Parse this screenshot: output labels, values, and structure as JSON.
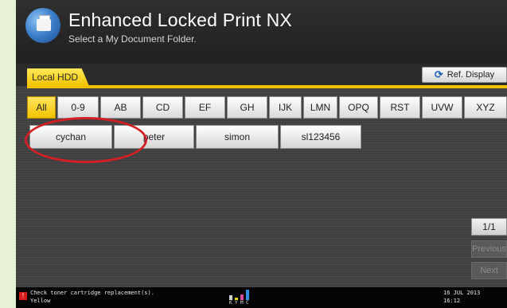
{
  "header": {
    "title": "Enhanced Locked Print NX",
    "subtitle": "Select a My Document Folder."
  },
  "tabs": {
    "local_hdd": "Local HDD"
  },
  "ref_display": {
    "label": "Ref. Display",
    "icon": "refresh-icon"
  },
  "index_filters": [
    "All",
    "0-9",
    "AB",
    "CD",
    "EF",
    "GH",
    "IJK",
    "LMN",
    "OPQ",
    "RST",
    "UVW",
    "XYZ"
  ],
  "active_filter": "All",
  "folders": [
    "cychan",
    "peter",
    "simon",
    "sl123456"
  ],
  "highlighted_folder": "cychan",
  "pagination": {
    "page": "1/1",
    "previous": "Previous",
    "next": "Next"
  },
  "status": {
    "message_line1": "Check toner cartridge replacement(s).",
    "message_line2": "Yellow",
    "date": "16 JUL  2013",
    "time": "16:12",
    "toner_labels": [
      "K",
      "Y",
      "M",
      "C"
    ]
  },
  "colors": {
    "accent_yellow": "#f2c200",
    "highlight_red": "#d21f26",
    "background_dark": "#3f3f3f"
  }
}
